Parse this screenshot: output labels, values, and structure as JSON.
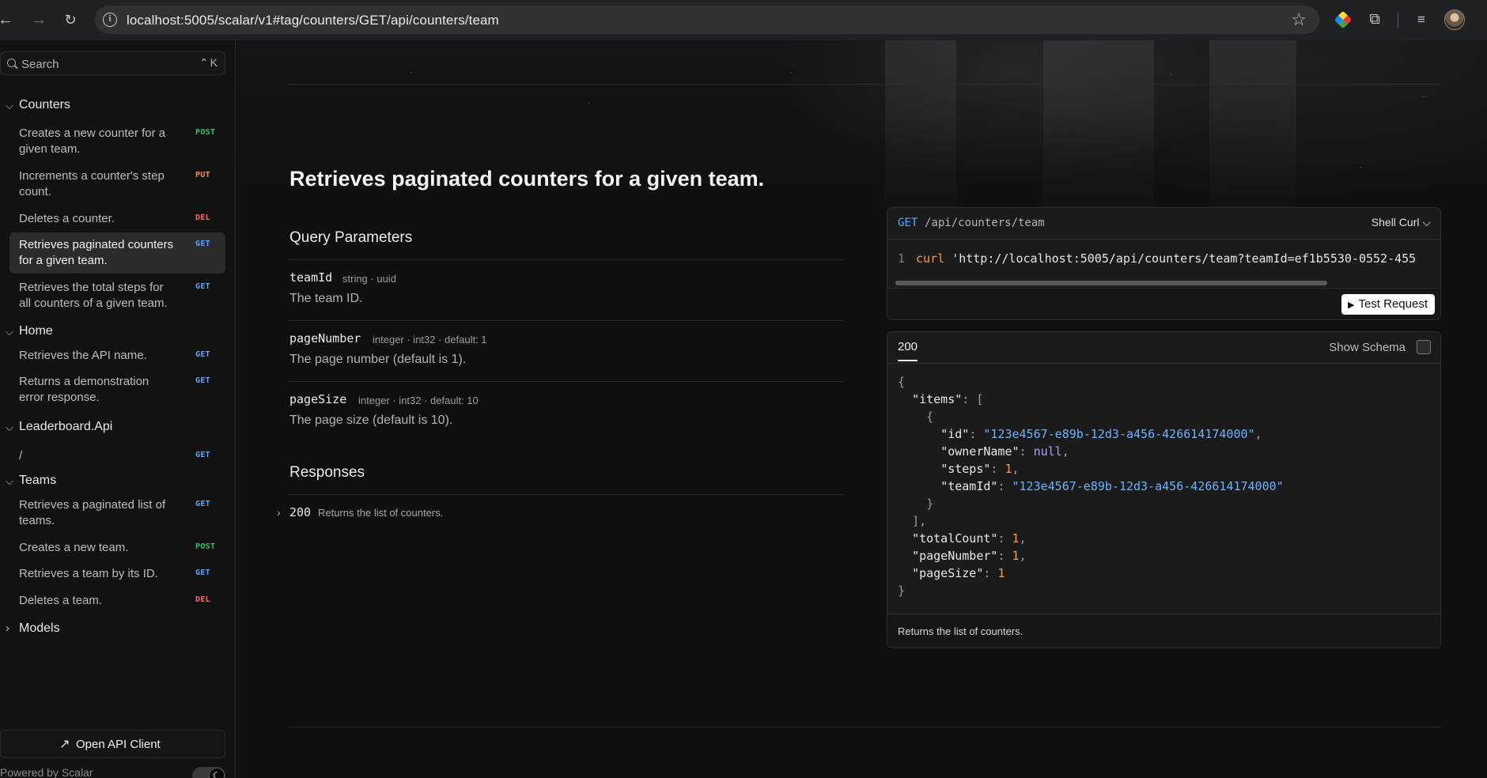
{
  "browser": {
    "url": "localhost:5005/scalar/v1#tag/counters/GET/api/counters/team"
  },
  "sidebar": {
    "search_placeholder": "Search",
    "search_shortcut": "⌃K",
    "groups": [
      {
        "label": "Counters"
      },
      {
        "label": "Home"
      },
      {
        "label": "Leaderboard.Api"
      },
      {
        "label": "Teams"
      },
      {
        "label": "Models"
      }
    ],
    "items": [
      {
        "label": "Creates a new counter for a given team.",
        "method": "POST"
      },
      {
        "label": "Increments a counter's step count.",
        "method": "PUT"
      },
      {
        "label": "Deletes a counter.",
        "method": "DEL"
      },
      {
        "label": "Retrieves paginated counters for a given team.",
        "method": "GET"
      },
      {
        "label": "Retrieves the total steps for all counters of a given team.",
        "method": "GET"
      },
      {
        "label": "Retrieves the API name.",
        "method": "GET"
      },
      {
        "label": "Returns a demonstration error response.",
        "method": "GET"
      },
      {
        "label": "/",
        "method": "GET"
      },
      {
        "label": "Retrieves a paginated list of teams.",
        "method": "GET"
      },
      {
        "label": "Creates a new team.",
        "method": "POST"
      },
      {
        "label": "Retrieves a team by its ID.",
        "method": "GET"
      },
      {
        "label": "Deletes a team.",
        "method": "DEL"
      }
    ],
    "open_client_label": "Open API Client",
    "powered_by": "Powered by Scalar"
  },
  "main": {
    "title": "Retrieves paginated counters for a given team.",
    "query_params_heading": "Query Parameters",
    "params": [
      {
        "name": "teamId",
        "meta": "string · uuid",
        "description": "The team ID."
      },
      {
        "name": "pageNumber",
        "meta": "integer · int32 · default: 1",
        "description": "The page number (default is 1)."
      },
      {
        "name": "pageSize",
        "meta": "integer · int32 · default: 10",
        "description": "The page size (default is 10)."
      }
    ],
    "responses_heading": "Responses",
    "responses": [
      {
        "code": "200",
        "description": "Returns the list of counters."
      }
    ]
  },
  "request_card": {
    "method": "GET",
    "path": "/api/counters/team",
    "language": "Shell Curl",
    "line_number": "1",
    "code_keyword": "curl",
    "code_string": "'http://localhost:5005/api/counters/team?teamId=ef1b5530-0552-455",
    "test_button": "Test Request"
  },
  "response_card": {
    "tab": "200",
    "show_schema_label": "Show Schema",
    "footer": "Returns the list of counters.",
    "json": {
      "items_key": "\"items\"",
      "id_key": "\"id\"",
      "id_value": "\"123e4567-e89b-12d3-a456-426614174000\"",
      "ownerName_key": "\"ownerName\"",
      "ownerName_value": "null",
      "steps_key": "\"steps\"",
      "steps_value": "1",
      "teamId_key": "\"teamId\"",
      "teamId_value": "\"123e4567-e89b-12d3-a456-426614174000\"",
      "totalCount_key": "\"totalCount\"",
      "totalCount_value": "1",
      "pageNumber_key": "\"pageNumber\"",
      "pageNumber_value": "1",
      "pageSize_key": "\"pageSize\"",
      "pageSize_value": "1"
    }
  },
  "colors": {
    "get": "#5aa7ff",
    "post": "#2fbf71",
    "put": "#ff8c42",
    "del": "#ff6b6b",
    "background": "#0f0f0f"
  }
}
